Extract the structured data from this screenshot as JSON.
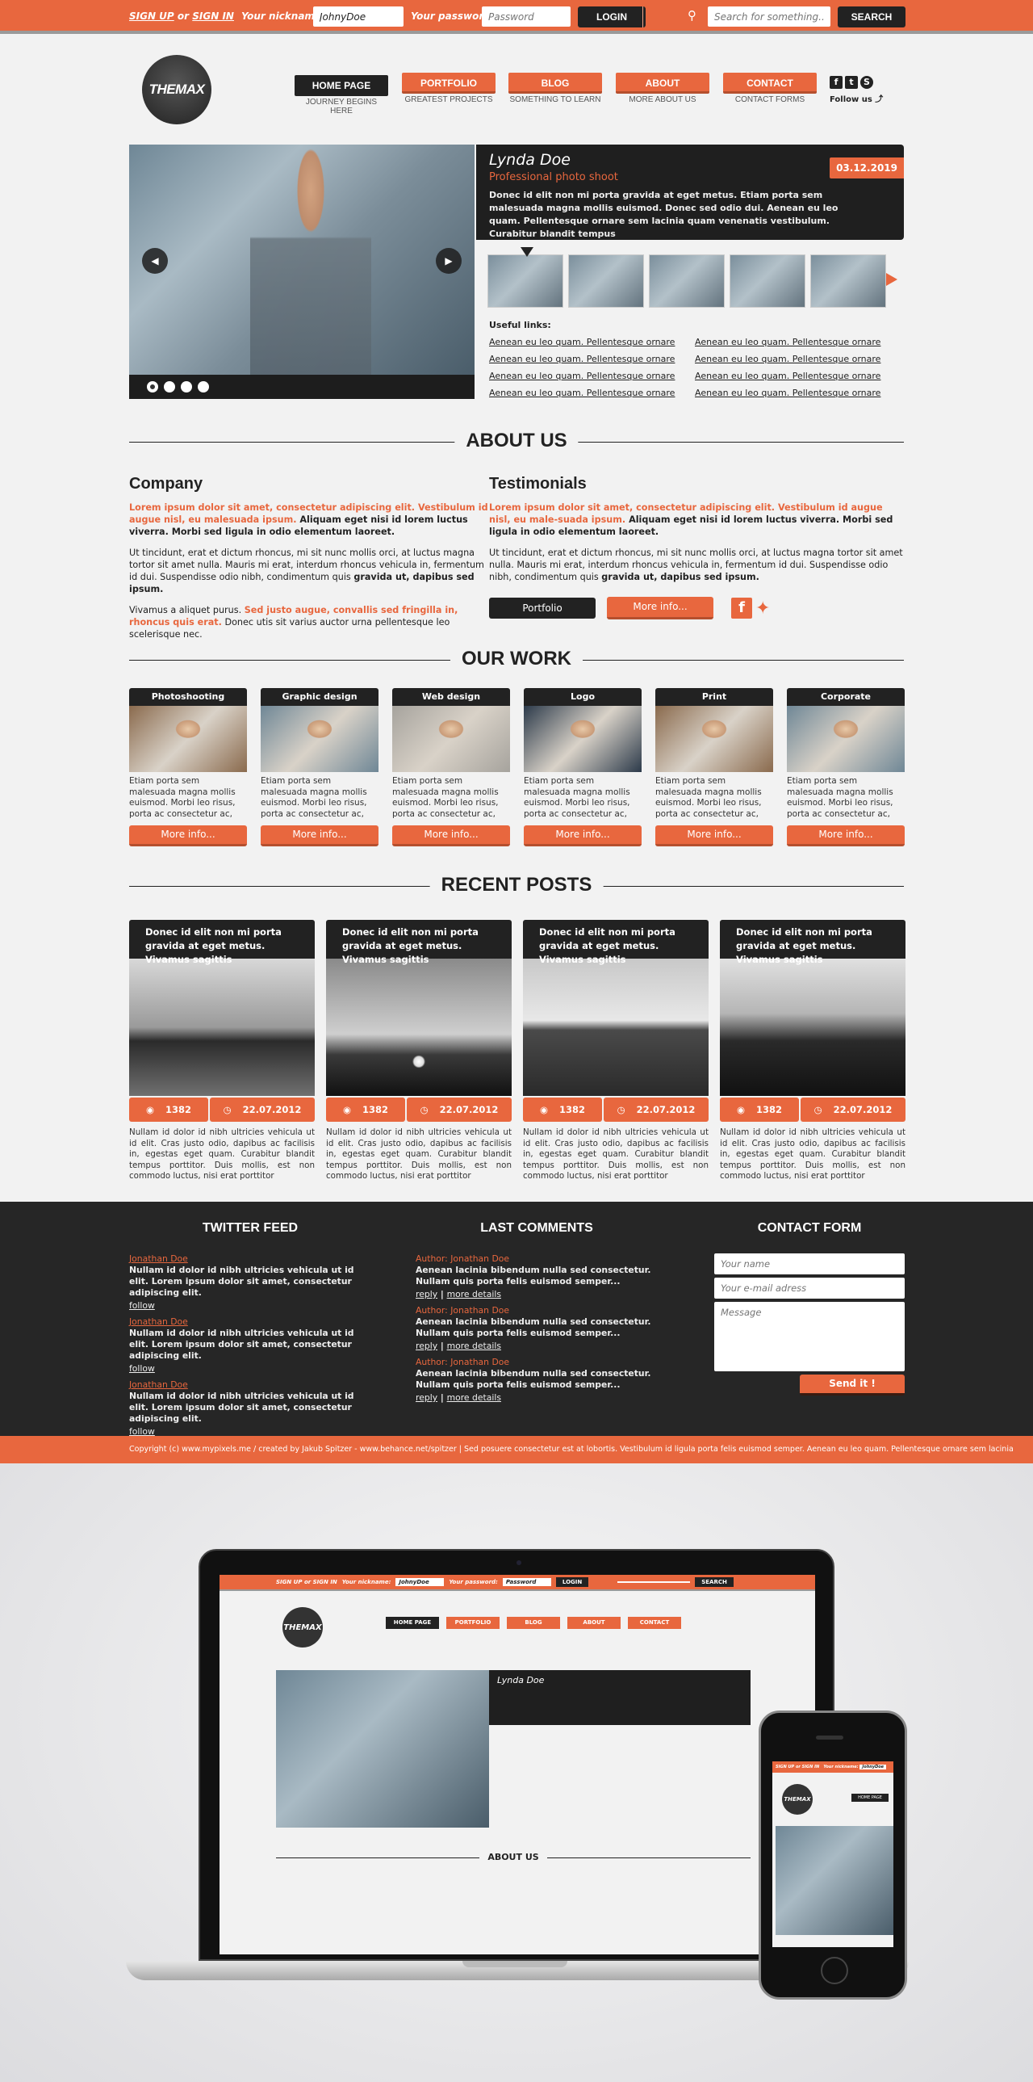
{
  "colors": {
    "accent": "#e8673e",
    "dark": "#222222",
    "footer_bg": "#262626",
    "page_bg": "#f2f2f2"
  },
  "topbar": {
    "sign_up": "SIGN UP",
    "or": "or",
    "sign_in": "SIGN IN",
    "nickname_label": "Your nickname:",
    "nickname_value": "JohnyDoe",
    "password_label": "Your password:",
    "password_placeholder": "Password",
    "login_label": "LOGIN",
    "search_icon": "magnifier-icon",
    "search_placeholder": "Search for something...",
    "search_label": "SEARCH"
  },
  "header": {
    "logo": "THEMAX",
    "nav": [
      {
        "label": "HOME PAGE",
        "sub": "JOURNEY BEGINS HERE",
        "active": true
      },
      {
        "label": "PORTFOLIO",
        "sub": "GREATEST PROJECTS"
      },
      {
        "label": "BLOG",
        "sub": "SOMETHING TO LEARN"
      },
      {
        "label": "ABOUT",
        "sub": "MORE ABOUT US"
      },
      {
        "label": "CONTACT",
        "sub": "CONTACT FORMS"
      }
    ],
    "follow_label": "Follow us",
    "social_icons": [
      "facebook-icon",
      "twitter-icon",
      "skype-icon"
    ]
  },
  "slider": {
    "prev_icon": "arrow-left-icon",
    "next_icon": "arrow-right-icon",
    "dots": 4,
    "active_dot": 1,
    "name": "Lynda Doe",
    "subtitle": "Professional photo shoot",
    "description": "Donec id elit non mi porta gravida at eget metus. Etiam porta sem malesuada magna mollis euismod. Donec sed odio dui. Aenean eu leo quam. Pellentesque ornare sem lacinia quam venenatis vestibulum. Curabitur blandit tempus",
    "date": "03.12.2019",
    "thumbnails": 5,
    "useful_links_title": "Useful links:",
    "useful_links": [
      "Aenean eu leo quam. Pellentesque ornare",
      "Aenean eu leo quam. Pellentesque ornare",
      "Aenean eu leo quam. Pellentesque ornare",
      "Aenean eu leo quam. Pellentesque ornare",
      "Aenean eu leo quam. Pellentesque ornare",
      "Aenean eu leo quam. Pellentesque ornare",
      "Aenean eu leo quam. Pellentesque ornare",
      "Aenean eu leo quam. Pellentesque ornare"
    ]
  },
  "about": {
    "heading": "ABOUT US",
    "company": {
      "title": "Company",
      "p1_orange": "Lorem ipsum dolor sit amet, consectetur adipiscing elit. Vestibulum id augue nisl, eu malesuada ipsum.",
      "p1_bold": " Aliquam eget nisi id lorem luctus viverra. Morbi sed ligula in odio elementum laoreet.",
      "p2_normal": "Ut tincidunt, erat et dictum rhoncus, mi sit nunc mollis orci, at luctus magna tortor sit amet nulla. Mauris mi erat, interdum rhoncus vehicula in, fermentum id dui. Suspendisse odio nibh, condimentum quis ",
      "p2_bold": "gravida ut, dapibus sed ipsum.",
      "p3_normal": "Vivamus a aliquet purus. ",
      "p3_orange": "Sed justo augue, convallis sed fringilla in, rhoncus quis erat.",
      "p3_end": " Donec utis sit varius auctor urna pellentesque leo scelerisque nec."
    },
    "testimonials": {
      "title": "Testimonials",
      "p1_orange": "Lorem ipsum dolor sit amet, consectetur adipiscing elit. Vestibulum id augue nisl, eu male-suada ipsum.",
      "p1_bold": " Aliquam eget nisi id lorem luctus viverra. Morbi sed ligula in odio elementum laoreet.",
      "p2_normal": "Ut tincidunt, erat et dictum rhoncus, mi sit nunc mollis orci, at luctus magna tortor sit amet nulla. Mauris mi erat, interdum rhoncus vehicula in, fermentum id dui. Suspendisse odio nibh, condimentum quis ",
      "p2_bold": "gravida ut, dapibus sed ipsum.",
      "portfolio_button": "Portfolio",
      "more_button": "More info..."
    }
  },
  "work": {
    "heading": "OUR WORK",
    "items": [
      {
        "title": "Photoshooting",
        "text": "Etiam porta sem malesuada magna mollis euismod. Morbi leo risus, porta ac consectetur ac, vestibulum at eros. Lorem",
        "button": "More info...",
        "tone": "#8a6a4d"
      },
      {
        "title": "Graphic design",
        "text": "Etiam porta sem malesuada magna mollis euismod. Morbi leo risus, porta ac consectetur ac, vestibulum at eros. Lorem",
        "button": "More info...",
        "tone": "#6f8796"
      },
      {
        "title": "Web design",
        "text": "Etiam porta sem malesuada magna mollis euismod. Morbi leo risus, porta ac consectetur ac, vestibulum at eros. Lorem",
        "button": "More info...",
        "tone": "#a6a39d"
      },
      {
        "title": "Logo",
        "text": "Etiam porta sem malesuada magna mollis euismod. Morbi leo risus, porta ac consectetur ac, vestibulum at eros. Lorem",
        "button": "More info...",
        "tone": "#2c3a4a"
      },
      {
        "title": "Print",
        "text": "Etiam porta sem malesuada magna mollis euismod. Morbi leo risus, porta ac consectetur ac, vestibulum at eros. Lorem",
        "button": "More info...",
        "tone": "#8a6a4d"
      },
      {
        "title": "Corporate",
        "text": "Etiam porta sem malesuada magna mollis euismod. Morbi leo risus, porta ac consectetur ac, vestibulum at eros. Lorem",
        "button": "More info...",
        "tone": "#6f8796"
      }
    ]
  },
  "posts": {
    "heading": "RECENT POSTS",
    "items": [
      {
        "title": "Donec id elit non mi porta gravida at eget metus. Vivamus sagittis",
        "views": "1382",
        "date": "22.07.2012",
        "text": "Nullam id dolor id nibh ultricies vehicula ut id elit. Cras justo odio, dapibus ac facilisis in, egestas eget quam. Curabitur blandit tempus porttitor. Duis mollis, est non commodo luctus, nisi erat porttitor"
      },
      {
        "title": "Donec id elit non mi porta gravida at eget metus. Vivamus sagittis",
        "views": "1382",
        "date": "22.07.2012",
        "text": "Nullam id dolor id nibh ultricies vehicula ut id elit. Cras justo odio, dapibus ac facilisis in, egestas eget quam. Curabitur blandit tempus porttitor. Duis mollis, est non commodo luctus, nisi erat porttitor"
      },
      {
        "title": "Donec id elit non mi porta gravida at eget metus. Vivamus sagittis",
        "views": "1382",
        "date": "22.07.2012",
        "text": "Nullam id dolor id nibh ultricies vehicula ut id elit. Cras justo odio, dapibus ac facilisis in, egestas eget quam. Curabitur blandit tempus porttitor. Duis mollis, est non commodo luctus, nisi erat porttitor"
      },
      {
        "title": "Donec id elit non mi porta gravida at eget metus. Vivamus sagittis",
        "views": "1382",
        "date": "22.07.2012",
        "text": "Nullam id dolor id nibh ultricies vehicula ut id elit. Cras justo odio, dapibus ac facilisis in, egestas eget quam. Curabitur blandit tempus porttitor. Duis mollis, est non commodo luctus, nisi erat porttitor"
      }
    ]
  },
  "footer": {
    "twitter": {
      "heading": "TWITTER FEED",
      "items": [
        {
          "author": "Jonathan Doe",
          "text": "Nullam id dolor id nibh ultricies vehicula ut id elit. Lorem ipsum dolor sit amet, consectetur adipiscing elit.",
          "link": "follow"
        },
        {
          "author": "Jonathan Doe",
          "text": "Nullam id dolor id nibh ultricies vehicula ut id elit. Lorem ipsum dolor sit amet, consectetur adipiscing elit.",
          "link": "follow"
        },
        {
          "author": "Jonathan Doe",
          "text": "Nullam id dolor id nibh ultricies vehicula ut id elit. Lorem ipsum dolor sit amet, consectetur adipiscing elit.",
          "link": "follow"
        }
      ]
    },
    "comments": {
      "heading": "LAST COMMENTS",
      "items": [
        {
          "author": "Author: Jonathan Doe",
          "text": "Aenean lacinia bibendum nulla sed consectetur. Nullam quis porta felis euismod semper...",
          "reply": "reply",
          "sep": "|",
          "more": "more details"
        },
        {
          "author": "Author: Jonathan Doe",
          "text": "Aenean lacinia bibendum nulla sed consectetur. Nullam quis porta felis euismod semper...",
          "reply": "reply",
          "sep": "|",
          "more": "more details"
        },
        {
          "author": "Author: Jonathan Doe",
          "text": "Aenean lacinia bibendum nulla sed consectetur. Nullam quis porta felis euismod semper...",
          "reply": "reply",
          "sep": "|",
          "more": "more details"
        }
      ]
    },
    "contact": {
      "heading": "CONTACT FORM",
      "name_placeholder": "Your name",
      "email_placeholder": "Your e-mail adress",
      "message_placeholder": "Message",
      "send": "Send it !"
    },
    "copyright": "Copyright (c) www.mypixels.me / created by Jakub Spitzer - www.behance.net/spitzer  |  Sed posuere consectetur est at lobortis. Vestibulum id ligula porta felis euismod semper. Aenean eu leo quam. Pellentesque ornare sem lacinia"
  },
  "mockup": {
    "laptop": {
      "sign": "SIGN UP or SIGN IN",
      "nickname_label": "Your nickname:",
      "nickname_value": "JohnyDoe",
      "password_label": "Your password:",
      "password_value": "Password",
      "login": "LOGIN",
      "search": "SEARCH",
      "logo": "THEMAX",
      "nav": [
        "HOME PAGE",
        "PORTFOLIO",
        "BLOG",
        "ABOUT",
        "CONTACT"
      ],
      "slide_name": "Lynda Doe",
      "about": "ABOUT US"
    },
    "phone": {
      "sign": "SIGN UP or SIGN IN",
      "nickname_label": "Your nickname:",
      "nickname_value": "JohnyDoe",
      "logo": "THEMAX",
      "home": "HOME PAGE"
    }
  }
}
